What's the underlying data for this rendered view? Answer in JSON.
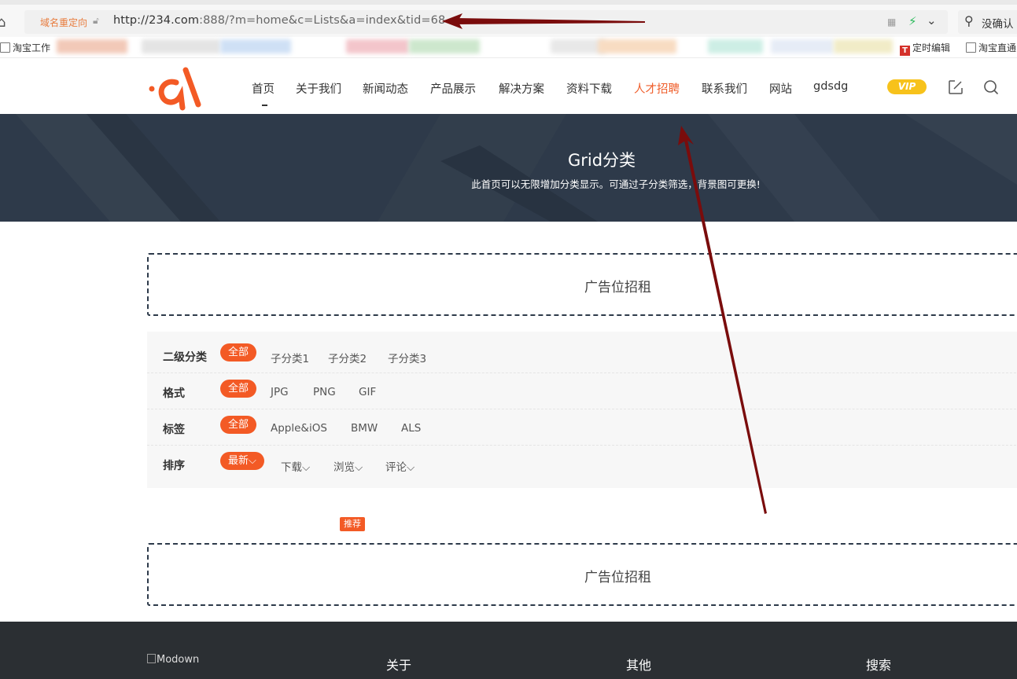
{
  "browser": {
    "redirect_label": "域名重定向",
    "url_host": "http://234.com",
    "url_rest": ":888/?m=home&c=Lists&a=index&tid=68",
    "search_text": "没确认",
    "bookmarks": [
      {
        "label": "淘宝工作"
      },
      {
        "label": "定时编辑"
      },
      {
        "label": "淘宝直通"
      }
    ]
  },
  "nav": {
    "items": [
      {
        "label": "首页"
      },
      {
        "label": "关于我们"
      },
      {
        "label": "新闻动态"
      },
      {
        "label": "产品展示"
      },
      {
        "label": "解决方案"
      },
      {
        "label": "资料下载"
      },
      {
        "label": "人才招聘"
      },
      {
        "label": "联系我们"
      },
      {
        "label": "网站"
      },
      {
        "label": "gdsdg"
      }
    ],
    "vip_label": "VIP"
  },
  "banner": {
    "title": "Grid分类",
    "subtitle": "此首页可以无限增加分类显示。可通过子分类筛选，背景图可更换!"
  },
  "ads": {
    "top_text": "广告位招租",
    "bottom_text": "广告位招租"
  },
  "filters": [
    {
      "label": "二级分类",
      "options": [
        "全部",
        "子分类1",
        "子分类2",
        "子分类3"
      ]
    },
    {
      "label": "格式",
      "options": [
        "全部",
        "JPG",
        "PNG",
        "GIF"
      ]
    },
    {
      "label": "标签",
      "options": [
        "全部",
        "Apple&iOS",
        "BMW",
        "ALS"
      ]
    },
    {
      "label": "排序",
      "options": [
        "最新",
        "下载",
        "浏览",
        "评论"
      ]
    }
  ],
  "recommend_badge": "推荐",
  "footer": {
    "logo_alt": "Modown",
    "columns": [
      "关于",
      "其他",
      "搜索"
    ]
  },
  "colors": {
    "accent": "#f35a25",
    "banner_bg": "#2e3a4a",
    "footer_bg": "#2b2f33",
    "vip": "#f7c21b"
  }
}
